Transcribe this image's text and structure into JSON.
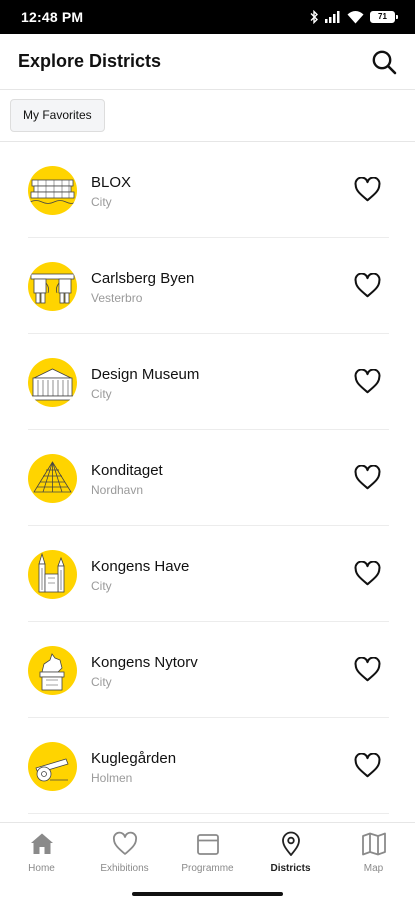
{
  "status": {
    "time": "12:48 PM",
    "battery": "71"
  },
  "header": {
    "title": "Explore Districts"
  },
  "filters": {
    "favorites_label": "My Favorites"
  },
  "districts": [
    {
      "name": "BLOX",
      "area": "City",
      "icon": "blox-building-icon"
    },
    {
      "name": "Carlsberg Byen",
      "area": "Vesterbro",
      "icon": "elephant-gate-icon"
    },
    {
      "name": "Design Museum",
      "area": "City",
      "icon": "museum-building-icon"
    },
    {
      "name": "Konditaget",
      "area": "Nordhavn",
      "icon": "rooftop-structure-icon"
    },
    {
      "name": "Kongens Have",
      "area": "City",
      "icon": "castle-towers-icon"
    },
    {
      "name": "Kongens Nytorv",
      "area": "City",
      "icon": "equestrian-statue-icon"
    },
    {
      "name": "Kuglegården",
      "area": "Holmen",
      "icon": "cannon-icon"
    }
  ],
  "nav": [
    {
      "label": "Home",
      "icon": "home-icon",
      "active": false
    },
    {
      "label": "Exhibitions",
      "icon": "heart-outline-icon",
      "active": false
    },
    {
      "label": "Programme",
      "icon": "calendar-icon",
      "active": false
    },
    {
      "label": "Districts",
      "icon": "location-pin-icon",
      "active": true
    },
    {
      "label": "Map",
      "icon": "map-icon",
      "active": false
    }
  ],
  "colors": {
    "accent": "#FFD400",
    "muted_text": "#9A9A9A",
    "divider": "#ECECEC",
    "chip_bg": "#F4F5F7"
  }
}
